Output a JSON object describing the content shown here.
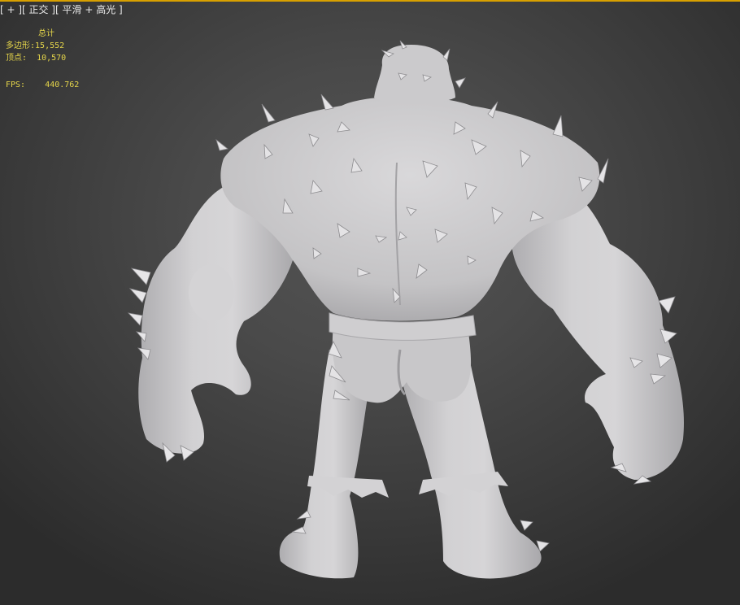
{
  "viewport": {
    "label": "[ + ][ 正交 ][ 平滑 + 高光 ]",
    "border_color": "#d8a000",
    "background_color": "#4a4a4a"
  },
  "stats": {
    "title": "总计",
    "polygons_label": "多边形:",
    "polygons_value": "15,552",
    "vertices_label": "顶点:",
    "vertices_value": "10,570",
    "fps_label": "FPS:",
    "fps_value": "440.762",
    "text_color": "#e6d64a"
  },
  "model": {
    "name": "spiked-brute-character-mesh",
    "shading": "smooth + highlights",
    "color": "#c9c8ca"
  }
}
